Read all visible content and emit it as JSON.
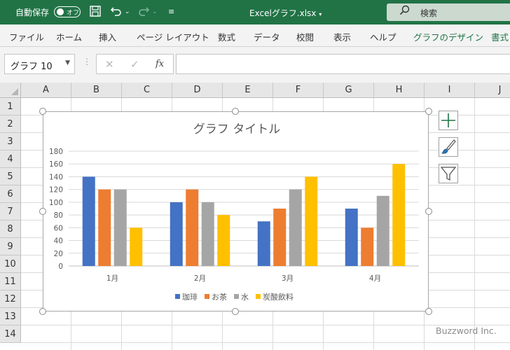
{
  "titlebar": {
    "autosave_label": "自動保存",
    "autosave_state": "オフ",
    "filename": "Excelグラフ.xlsx",
    "search_placeholder": "検索"
  },
  "ribbon": {
    "tabs": [
      "ファイル",
      "ホーム",
      "挿入",
      "ページ レイアウト",
      "数式",
      "データ",
      "校閲",
      "表示",
      "ヘルプ",
      "グラフのデザイン",
      "書式"
    ]
  },
  "formula_bar": {
    "name_box": "グラフ 10",
    "formula": ""
  },
  "sheet": {
    "columns": [
      "A",
      "B",
      "C",
      "D",
      "E",
      "F",
      "G",
      "H",
      "I",
      "J"
    ],
    "rows": [
      "1",
      "2",
      "3",
      "4",
      "5",
      "6",
      "7",
      "8",
      "9",
      "10",
      "11",
      "12",
      "13",
      "14"
    ]
  },
  "chart_data": {
    "type": "bar",
    "title": "グラフ タイトル",
    "categories": [
      "1月",
      "2月",
      "3月",
      "4月"
    ],
    "series": [
      {
        "name": "珈琲",
        "color": "#4472c4",
        "values": [
          140,
          100,
          70,
          90
        ]
      },
      {
        "name": "お茶",
        "color": "#ed7d31",
        "values": [
          120,
          120,
          90,
          60
        ]
      },
      {
        "name": "水",
        "color": "#a5a5a5",
        "values": [
          120,
          100,
          120,
          110
        ]
      },
      {
        "name": "炭酸飲料",
        "color": "#ffc000",
        "values": [
          60,
          80,
          140,
          160
        ]
      }
    ],
    "ylim": [
      0,
      180
    ],
    "yticks": [
      0,
      20,
      40,
      60,
      80,
      100,
      120,
      140,
      160,
      180
    ],
    "grid": true,
    "legend": "bottom"
  },
  "chart_tools": [
    {
      "name": "chart-elements",
      "icon": "plus-icon"
    },
    {
      "name": "chart-styles",
      "icon": "brush-icon"
    },
    {
      "name": "chart-filters",
      "icon": "filter-icon"
    }
  ],
  "watermark": "Buzzword Inc."
}
